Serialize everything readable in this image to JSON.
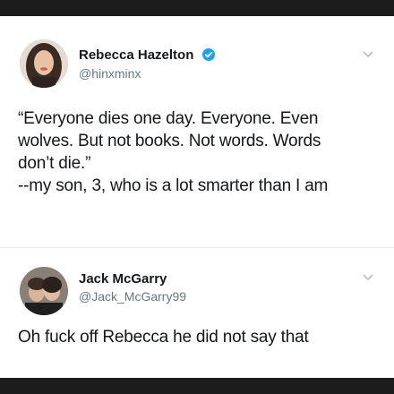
{
  "tweets": [
    {
      "author_name": "Rebecca Hazelton",
      "author_handle": "@hinxminx",
      "verified": true,
      "text_lines": [
        "“Everyone dies one day. Everyone. Even",
        "wolves. But not books. Not words. Words",
        "don’t die.”",
        "--my son, 3, who is a lot smarter than I am"
      ]
    },
    {
      "author_name": "Jack McGarry",
      "author_handle": "@Jack_McGarry99",
      "verified": false,
      "text_lines": [
        "Oh fuck off Rebecca he did not say that"
      ]
    }
  ],
  "colors": {
    "background": "#1c1c1c",
    "card": "#ffffff",
    "verified_badge": "#1da1f2",
    "handle": "#657786",
    "text": "#14171a"
  },
  "icons": {
    "verified": "verified-badge-icon",
    "menu": "chevron-down-icon"
  }
}
